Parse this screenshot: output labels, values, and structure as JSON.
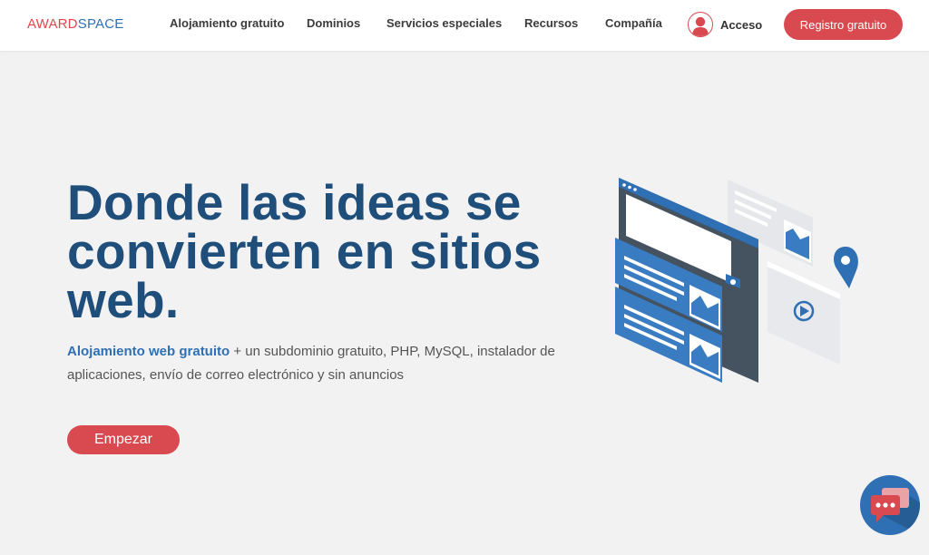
{
  "brand": {
    "part1": "AWARD",
    "part2": "SPACE"
  },
  "nav": {
    "items": [
      {
        "label": "Alojamiento gratuito"
      },
      {
        "label": "Dominios"
      },
      {
        "label": "Servicios especiales"
      },
      {
        "label": "Recursos"
      },
      {
        "label": "Compañía"
      }
    ],
    "login_label": "Acceso",
    "register_label": "Registro gratuito"
  },
  "hero": {
    "title_lines": [
      "Donde las ideas se",
      "convierten en sitios",
      "web."
    ],
    "link_text": "Alojamiento web gratuito",
    "description": " + un subdominio gratuito, PHP, MySQL, instalador de aplicaciones, envío de correo electrónico y sin anuncios",
    "cta_label": "Empezar"
  },
  "icons": {
    "avatar": "user-avatar-icon",
    "chat": "chat-bubbles-icon",
    "location": "location-pin-icon",
    "play": "play-icon",
    "image": "image-icon"
  },
  "colors": {
    "brand_red": "#d84a4f",
    "brand_blue": "#2f6fb3",
    "title_navy": "#1f4e7a",
    "background": "#f2f2f3"
  }
}
